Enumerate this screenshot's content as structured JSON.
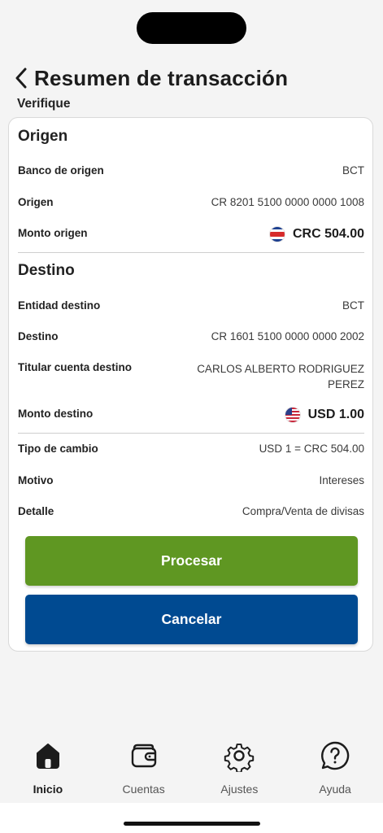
{
  "header": {
    "title": "Resumen de transacción",
    "subtitle": "Verifique"
  },
  "origin": {
    "section_title": "Origen",
    "bank_label": "Banco de origen",
    "bank_value": "BCT",
    "account_label": "Origen",
    "account_value": "CR 8201 5100 0000 0000 1008",
    "amount_label": "Monto origen",
    "amount_value": "CRC 504.00"
  },
  "destination": {
    "section_title": "Destino",
    "entity_label": "Entidad destino",
    "entity_value": "BCT",
    "account_label": "Destino",
    "account_value": "CR 1601 5100 0000 0000 2002",
    "holder_label": "Titular cuenta destino",
    "holder_value": "CARLOS ALBERTO RODRIGUEZ PEREZ",
    "amount_label": "Monto destino",
    "amount_value": "USD 1.00"
  },
  "details": {
    "exchange_label": "Tipo de cambio",
    "exchange_value": "USD 1 = CRC 504.00",
    "reason_label": "Motivo",
    "reason_value": "Intereses",
    "detail_label": "Detalle",
    "detail_value": "Compra/Venta de divisas"
  },
  "buttons": {
    "process": "Procesar",
    "cancel": "Cancelar"
  },
  "nav": {
    "items": [
      {
        "label": "Inicio",
        "icon": "home-icon",
        "active": true
      },
      {
        "label": "Cuentas",
        "icon": "wallet-icon",
        "active": false
      },
      {
        "label": "Ajustes",
        "icon": "gear-icon",
        "active": false
      },
      {
        "label": "Ayuda",
        "icon": "help-icon",
        "active": false
      }
    ]
  },
  "colors": {
    "primary_green": "#5f9722",
    "primary_blue": "#004a91"
  }
}
